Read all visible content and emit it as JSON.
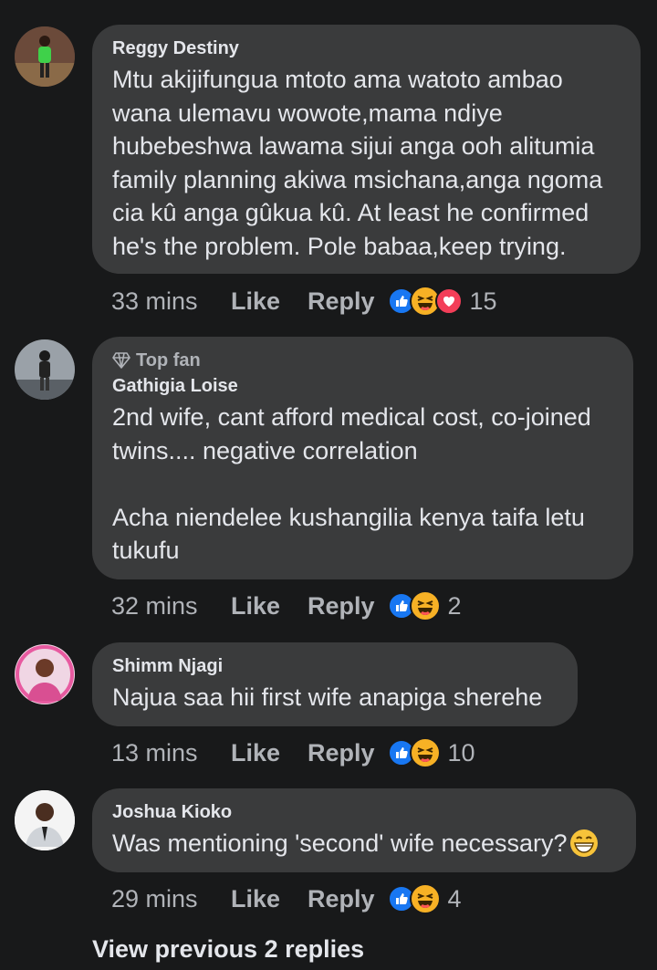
{
  "comments": [
    {
      "name": "Reggy Destiny",
      "badge": "",
      "text": "Mtu akijifungua mtoto ama watoto ambao wana ulemavu wowote,mama ndiye hubebeshwa lawama sijui anga ooh alitumia family planning akiwa msichana,anga ngoma cia kû anga gûkua kû. At least he confirmed he's the problem. Pole babaa,keep trying.",
      "time": "33 mins",
      "like": "Like",
      "reply": "Reply",
      "reactions": [
        "like-icon",
        "haha-icon",
        "love-icon"
      ],
      "count": "15"
    },
    {
      "name": "Gathigia Loise",
      "badge": "Top fan",
      "text": "2nd wife, cant afford medical cost, co-joined twins.... negative correlation\n\nAcha niendelee kushangilia kenya taifa letu tukufu",
      "time": "32 mins",
      "like": "Like",
      "reply": "Reply",
      "reactions": [
        "like-icon",
        "haha-icon"
      ],
      "count": "2"
    },
    {
      "name": "Shimm Njagi",
      "badge": "",
      "text": "Najua saa hii first wife anapiga sherehe",
      "time": "13 mins",
      "like": "Like",
      "reply": "Reply",
      "reactions": [
        "like-icon",
        "haha-icon"
      ],
      "count": "10"
    },
    {
      "name": "Joshua Kioko",
      "badge": "",
      "text": "Was mentioning 'second' wife necessary?",
      "time": "29 mins",
      "like": "Like",
      "reply": "Reply",
      "reactions": [
        "like-icon",
        "haha-icon"
      ],
      "count": "4"
    }
  ],
  "view_previous": "View previous 2 replies",
  "colors": {
    "background": "#18191a",
    "bubble": "#3a3b3c",
    "like": "#1877f2",
    "haha": "#f7b125",
    "love": "#f33e58"
  }
}
